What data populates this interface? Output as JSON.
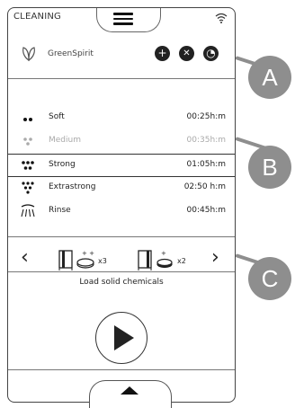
{
  "header": {
    "title": "CLEANING",
    "menu_icon": "hamburger-icon",
    "status_icon": "wifi-icon"
  },
  "brand": {
    "name": "GreenSpirit",
    "logo_icon": "leaf-icon",
    "actions": [
      {
        "icon": "plus-icon",
        "glyph": "+"
      },
      {
        "icon": "close-icon",
        "glyph": "✕"
      },
      {
        "icon": "gauge-icon",
        "glyph": "◔"
      }
    ]
  },
  "programs": [
    {
      "label": "Soft",
      "time": "00:25h:m",
      "icon": "two-drops-icon",
      "state": "normal"
    },
    {
      "label": "Medium",
      "time": "00:35h:m",
      "icon": "three-drops-icon",
      "state": "disabled"
    },
    {
      "label": "Strong",
      "time": "01:05h:m",
      "icon": "five-drops-icon",
      "state": "selected"
    },
    {
      "label": "Extrastrong",
      "time": "02:50 h:m",
      "icon": "seven-drops-icon",
      "state": "normal"
    },
    {
      "label": "Rinse",
      "time": "00:45h:m",
      "icon": "shower-icon",
      "state": "normal"
    }
  ],
  "chemicals": {
    "prev_glyph": "‹",
    "next_glyph": "›",
    "items": [
      {
        "count": "x3",
        "icon": "tablet-cabinet-icon"
      },
      {
        "count": "x2",
        "icon": "tablet-cabinet-icon"
      }
    ],
    "instruction": "Load solid chemicals"
  },
  "start": {
    "icon": "play-icon"
  },
  "callouts": [
    {
      "letter": "A"
    },
    {
      "letter": "B"
    },
    {
      "letter": "C"
    }
  ]
}
